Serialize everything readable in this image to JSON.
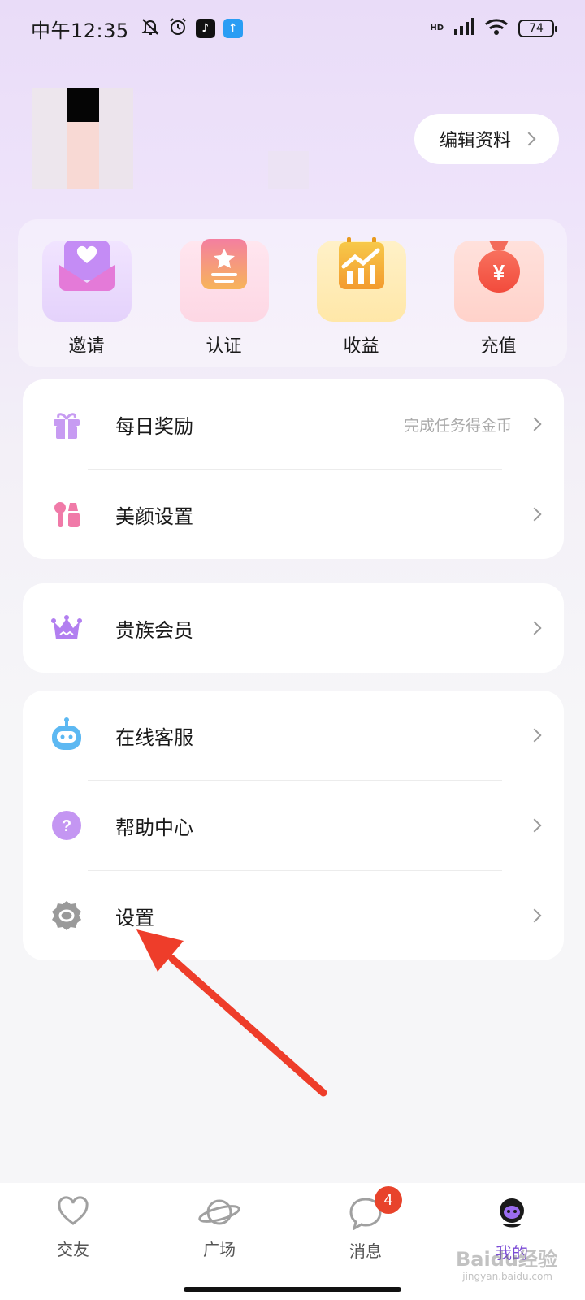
{
  "status_bar": {
    "time": "中午12:35",
    "network": "HD",
    "battery": "74"
  },
  "profile": {
    "edit_label": "编辑资料"
  },
  "quick_actions": [
    {
      "label": "邀请",
      "icon": "envelope-heart-icon",
      "color": "#b67cf0"
    },
    {
      "label": "认证",
      "icon": "badge-star-icon",
      "color": "#f08aa0"
    },
    {
      "label": "收益",
      "icon": "calendar-chart-icon",
      "color": "#f3b23e"
    },
    {
      "label": "充值",
      "icon": "money-bag-icon",
      "color": "#f56a5a"
    }
  ],
  "menu_group1": [
    {
      "label": "每日奖励",
      "hint": "完成任务得金币",
      "icon": "gift-icon"
    },
    {
      "label": "美颜设置",
      "icon": "makeup-icon"
    }
  ],
  "menu_group2": [
    {
      "label": "贵族会员",
      "icon": "crown-icon"
    }
  ],
  "menu_group3": [
    {
      "label": "在线客服",
      "icon": "robot-icon"
    },
    {
      "label": "帮助中心",
      "icon": "question-icon"
    },
    {
      "label": "设置",
      "icon": "gear-icon"
    }
  ],
  "bottom_nav": [
    {
      "label": "交友",
      "icon": "heart-icon"
    },
    {
      "label": "广场",
      "icon": "planet-icon"
    },
    {
      "label": "消息",
      "icon": "chat-icon",
      "badge": "4"
    },
    {
      "label": "我的",
      "icon": "profile-icon"
    }
  ],
  "watermark": {
    "text": "Baidu经验",
    "sub": "jingyan.baidu.com"
  },
  "colors": {
    "accent": "#7b4bd6",
    "arrow": "#ee3d2a",
    "badge": "#e8432b"
  }
}
